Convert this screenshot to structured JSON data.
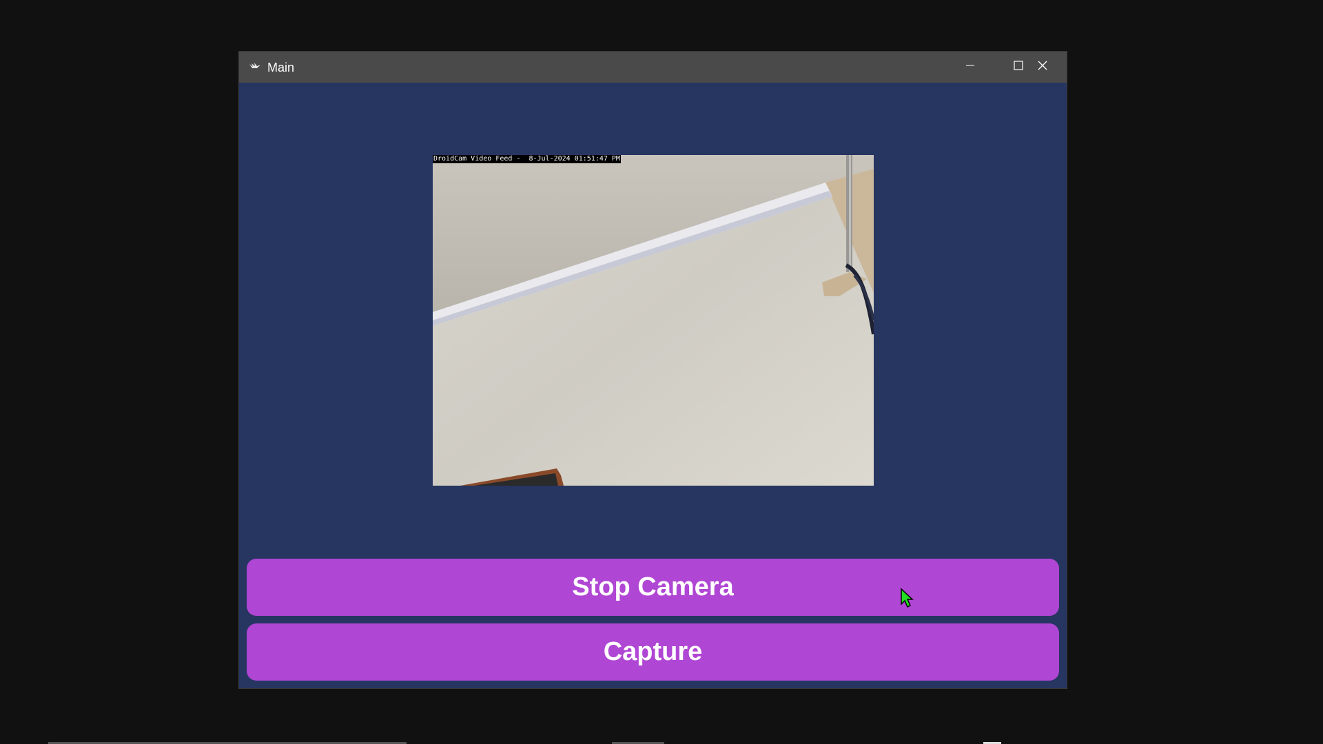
{
  "window": {
    "title": "Main",
    "controls": {
      "minimize": "minimize-icon",
      "maximize": "maximize-icon",
      "close": "close-icon"
    }
  },
  "camera": {
    "overlay_text": "DroidCam Video Feed -  8-Jul-2024 01:51:47 PM"
  },
  "buttons": {
    "stop_camera": "Stop Camera",
    "capture": "Capture"
  },
  "colors": {
    "window_bg": "#273561",
    "titlebar_bg": "#4a4a4a",
    "button_bg": "#b046d4",
    "button_text": "#ffffff",
    "cursor": "#22dd22"
  }
}
